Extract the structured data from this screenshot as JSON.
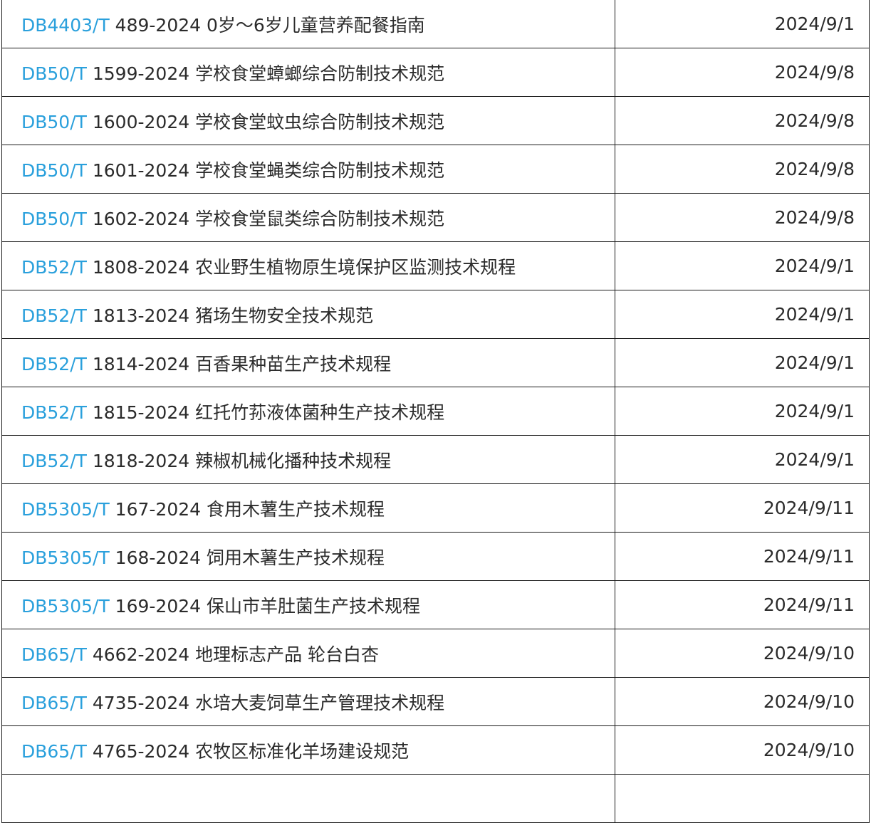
{
  "rows": [
    {
      "code": "DB4403/T",
      "title": "489-2024 0岁～6岁儿童营养配餐指南",
      "date": "2024/9/1"
    },
    {
      "code": "DB50/T",
      "title": "1599-2024 学校食堂蟑螂综合防制技术规范",
      "date": "2024/9/8"
    },
    {
      "code": "DB50/T",
      "title": "1600-2024 学校食堂蚊虫综合防制技术规范",
      "date": "2024/9/8"
    },
    {
      "code": "DB50/T",
      "title": "1601-2024 学校食堂蝇类综合防制技术规范",
      "date": "2024/9/8"
    },
    {
      "code": "DB50/T",
      "title": "1602-2024 学校食堂鼠类综合防制技术规范",
      "date": "2024/9/8"
    },
    {
      "code": "DB52/T",
      "title": "1808-2024 农业野生植物原生境保护区监测技术规程",
      "date": "2024/9/1"
    },
    {
      "code": "DB52/T",
      "title": "1813-2024 猪场生物安全技术规范",
      "date": "2024/9/1"
    },
    {
      "code": "DB52/T",
      "title": "1814-2024 百香果种苗生产技术规程",
      "date": "2024/9/1"
    },
    {
      "code": "DB52/T",
      "title": "1815-2024 红托竹荪液体菌种生产技术规程",
      "date": "2024/9/1"
    },
    {
      "code": "DB52/T",
      "title": "1818-2024 辣椒机械化播种技术规程",
      "date": "2024/9/1"
    },
    {
      "code": "DB5305/T",
      "title": "167-2024 食用木薯生产技术规程",
      "date": "2024/9/11"
    },
    {
      "code": "DB5305/T",
      "title": "168-2024 饲用木薯生产技术规程",
      "date": "2024/9/11"
    },
    {
      "code": "DB5305/T",
      "title": "169-2024 保山市羊肚菌生产技术规程",
      "date": "2024/9/11"
    },
    {
      "code": "DB65/T",
      "title": "4662-2024 地理标志产品 轮台白杏",
      "date": "2024/9/10"
    },
    {
      "code": "DB65/T",
      "title": "4735-2024 水培大麦饲草生产管理技术规程",
      "date": "2024/9/10"
    },
    {
      "code": "DB65/T",
      "title": "4765-2024 农牧区标准化羊场建设规范",
      "date": "2024/9/10"
    }
  ],
  "colors": {
    "code_link": "#2aa0dc",
    "text": "#2b2b2b",
    "border": "#1a1a1a"
  }
}
